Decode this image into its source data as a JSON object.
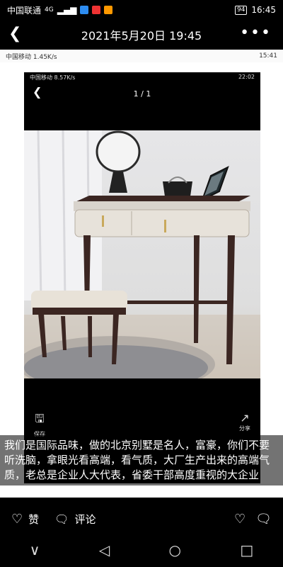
{
  "status": {
    "carrier": "中国联通",
    "network": "4G",
    "battery": "94",
    "time": "16:45"
  },
  "header": {
    "back_icon": "chevron-left-icon",
    "title": "2021年5月20日 19:45",
    "more_icon": "more-dots-icon"
  },
  "inner_status": {
    "carrier": "中国移动",
    "speed": "1.45K/s",
    "time": "15:41"
  },
  "viewer": {
    "carrier": "中国移动",
    "speed": "8.57K/s",
    "time": "22:02",
    "counter": "1 / 1",
    "save_label": "保存",
    "share_label": "分享"
  },
  "caption": "我们是国际品味，做的北京别墅是名人，富豪，你们不要听洗脑，拿眼光看高端，看气质，大厂生产出来的高端气质，老总是企业人大代表，省委干部高度重视的大企业",
  "actions": {
    "like_label": "赞",
    "comment_label": "评论"
  },
  "colors": {
    "background": "#000000",
    "furniture_wood": "#3b2622",
    "furniture_top": "#d8d3cc"
  }
}
